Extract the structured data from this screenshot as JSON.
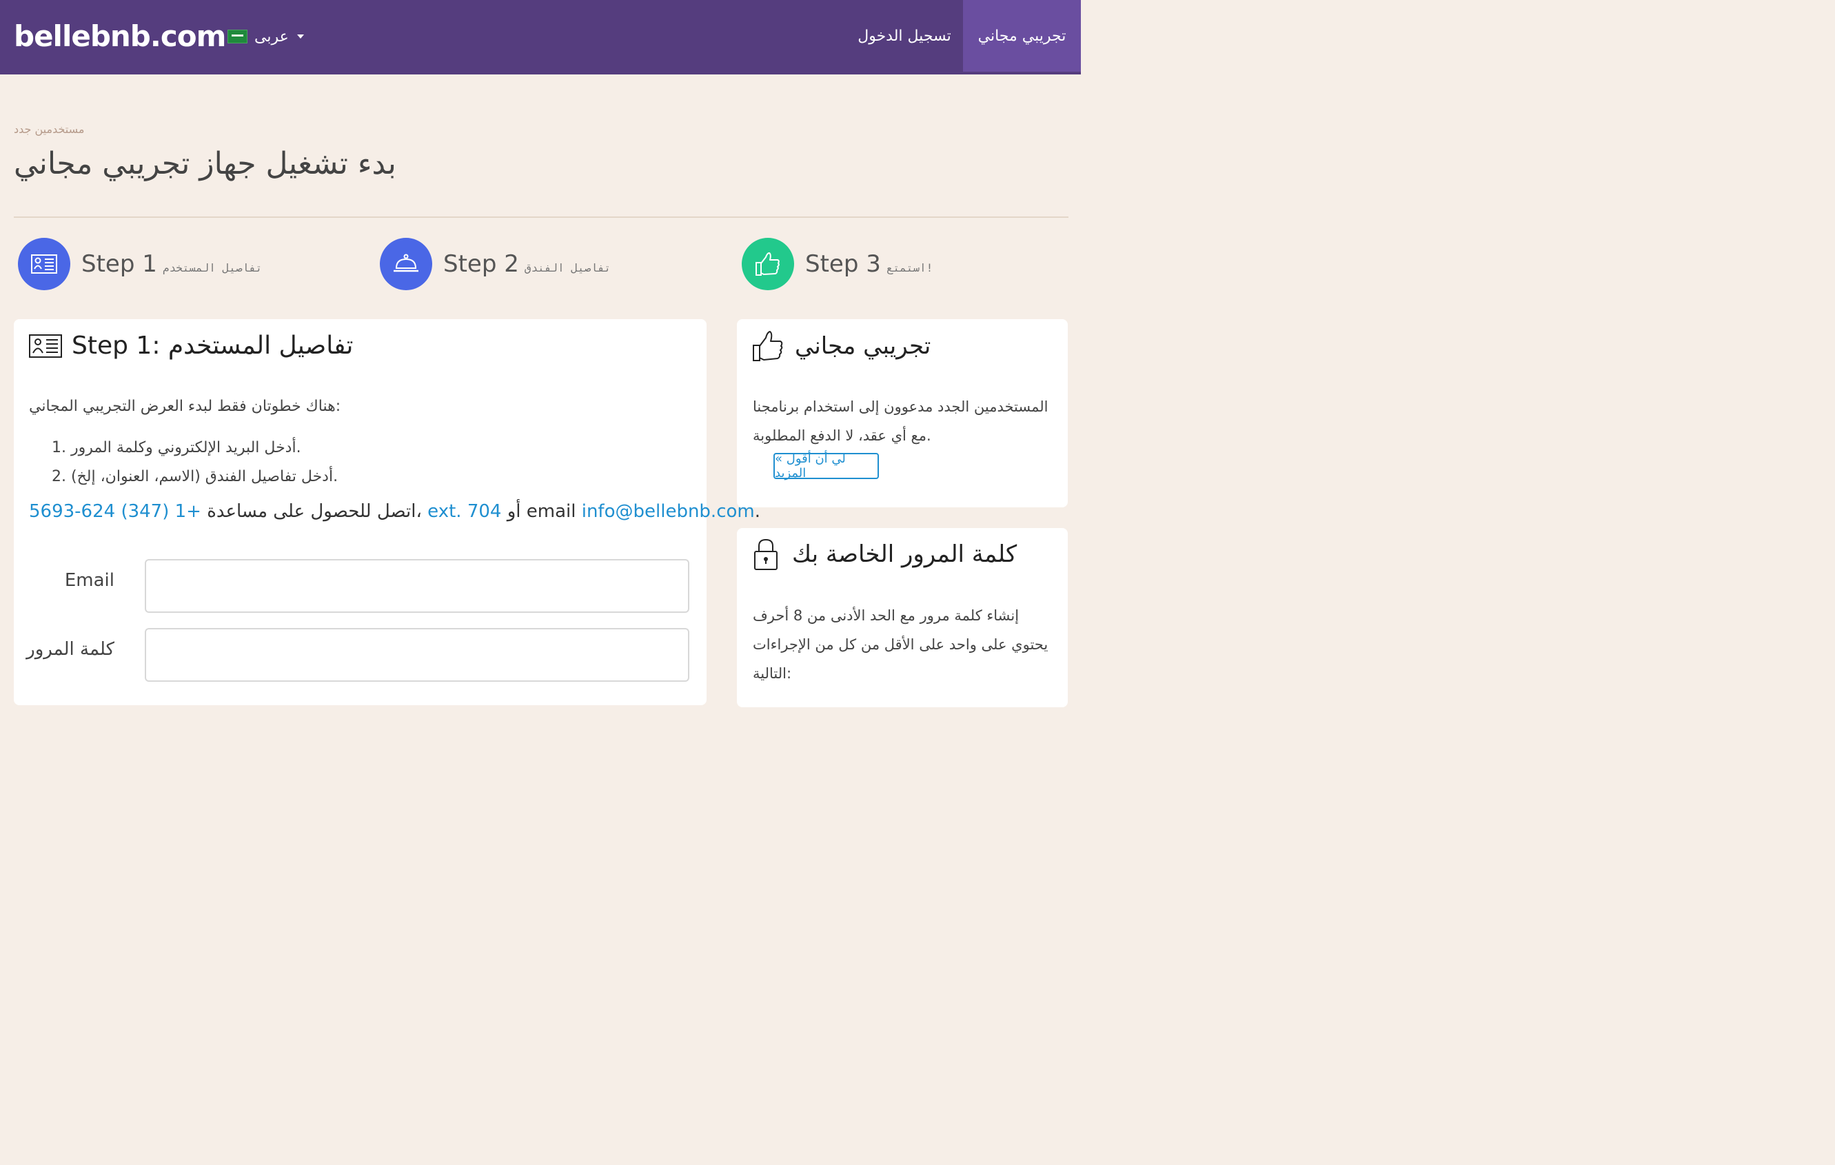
{
  "navbar": {
    "brand": "bellebnb.com",
    "language": "عربى",
    "login": "تسجيل الدخول",
    "free_trial": "تجريبي مجاني"
  },
  "header": {
    "breadcrumb": "مستخدمين جدد",
    "title": "بدء تشغيل جهاز تجريبي مجاني"
  },
  "steps": [
    {
      "label": "Step 1",
      "sub": "تفاصيل المستخدم",
      "color": "#4a67e6",
      "icon": "id-card-icon"
    },
    {
      "label": "Step 2",
      "sub": "تفاصيل الفندق",
      "color": "#4a67e6",
      "icon": "bell-icon"
    },
    {
      "label": "Step 3",
      "sub": "استمتع!",
      "color": "#22c98c",
      "icon": "thumbs-up-icon"
    }
  ],
  "main": {
    "title": "Step 1: تفاصيل المستخدم",
    "intro": "هناك خطوتان فقط لبدء العرض التجريبي المجاني:",
    "list": [
      "1. أدخل البريد الإلكتروني وكلمة المرور.",
      "2. أدخل تفاصيل الفندق (الاسم، العنوان، إلخ)."
    ],
    "help_phone": "5693-624 (347) 1+",
    "help_text1": " اتصل للحصول على مساعدة، ",
    "help_ext": "ext. 704",
    "help_text2": " أو email ",
    "help_email": "info@bellebnb.com",
    "help_end": ".",
    "email_label": "Email",
    "password_label": "كلمة المرور"
  },
  "side1": {
    "title": "تجريبي مجاني",
    "text1": "المستخدمين الجدد مدعوون إلى استخدام برنامجنا",
    "text2": "مع أي عقد، لا الدفع المطلوبة.",
    "more": "« لي أن أقول المزيد"
  },
  "side2": {
    "title": "كلمة المرور الخاصة بك",
    "text1": "إنشاء كلمة مرور مع الحد الأدنى من 8 أحرف",
    "text2": "يحتوي على واحد على الأقل من كل من الإجراءات",
    "text3": "التالية:"
  }
}
